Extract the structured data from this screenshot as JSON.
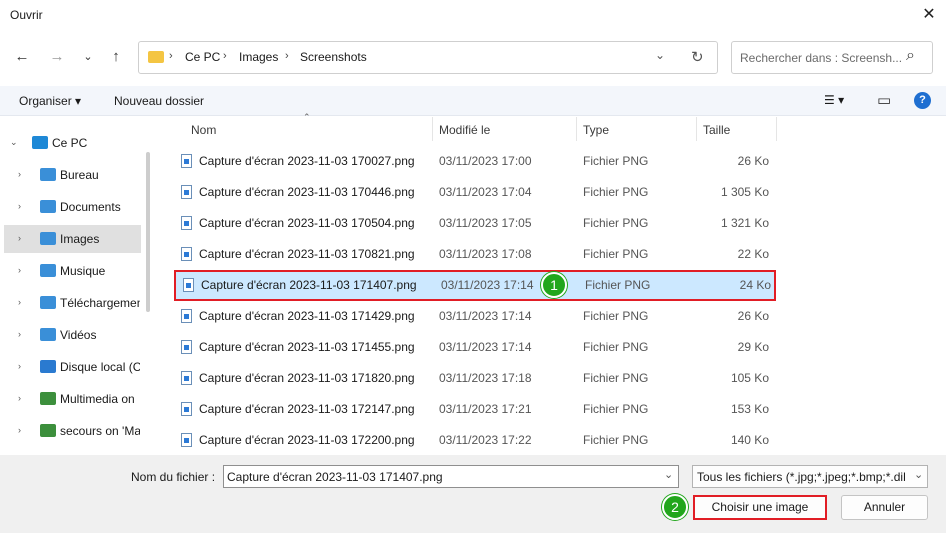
{
  "window": {
    "title": "Ouvrir",
    "close_glyph": "✕"
  },
  "nav": {
    "back": "←",
    "forward": "→",
    "recent": "⌄",
    "up": "↑",
    "breadcrumb": [
      "Ce PC",
      "Images",
      "Screenshots"
    ],
    "separator": "›",
    "dropdown_glyph": "⌄",
    "refresh_glyph": "↻",
    "search_placeholder": "Rechercher dans : Screensh...",
    "search_glyph": "⌕"
  },
  "toolbar": {
    "organize": "Organiser ▾",
    "new_folder": "Nouveau dossier",
    "view_glyph": "☰ ▾",
    "pane_glyph": "▭",
    "help_glyph": "?"
  },
  "sidebar": {
    "items": [
      {
        "label": "Ce PC",
        "chevron": "⌄",
        "icon": "monitor-icon",
        "color": "#1e88d6"
      },
      {
        "label": "Bureau",
        "chevron": "›",
        "icon": "desktop-folder-icon",
        "color": "#3a8fd8"
      },
      {
        "label": "Documents",
        "chevron": "›",
        "icon": "documents-folder-icon",
        "color": "#3a8fd8"
      },
      {
        "label": "Images",
        "chevron": "›",
        "icon": "images-folder-icon",
        "color": "#3a8fd8"
      },
      {
        "label": "Musique",
        "chevron": "›",
        "icon": "music-folder-icon",
        "color": "#3a8fd8"
      },
      {
        "label": "Téléchargements",
        "chevron": "›",
        "icon": "downloads-folder-icon",
        "color": "#3a8fd8"
      },
      {
        "label": "Vidéos",
        "chevron": "›",
        "icon": "videos-folder-icon",
        "color": "#3a8fd8"
      },
      {
        "label": "Disque local (C:)",
        "chevron": "›",
        "icon": "windows-drive-icon",
        "color": "#2a7ad0"
      },
      {
        "label": "Multimedia on",
        "chevron": "›",
        "icon": "network-drive-icon",
        "color": "#3c8f3c"
      },
      {
        "label": "secours on 'Ma",
        "chevron": "›",
        "icon": "network-drive-icon",
        "color": "#3c8f3c"
      }
    ],
    "selected_index": 3
  },
  "columns": {
    "name": "Nom",
    "modified": "Modifié le",
    "type": "Type",
    "size": "Taille",
    "sort_glyph": "⌃"
  },
  "files": [
    {
      "name": "Capture d'écran 2023-11-03 170027.png",
      "modified": "03/11/2023 17:00",
      "type": "Fichier PNG",
      "size": "26 Ko"
    },
    {
      "name": "Capture d'écran 2023-11-03 170446.png",
      "modified": "03/11/2023 17:04",
      "type": "Fichier PNG",
      "size": "1 305 Ko"
    },
    {
      "name": "Capture d'écran 2023-11-03 170504.png",
      "modified": "03/11/2023 17:05",
      "type": "Fichier PNG",
      "size": "1 321 Ko"
    },
    {
      "name": "Capture d'écran 2023-11-03 170821.png",
      "modified": "03/11/2023 17:08",
      "type": "Fichier PNG",
      "size": "22 Ko"
    },
    {
      "name": "Capture d'écran 2023-11-03 171407.png",
      "modified": "03/11/2023 17:14",
      "type": "Fichier PNG",
      "size": "24 Ko"
    },
    {
      "name": "Capture d'écran 2023-11-03 171429.png",
      "modified": "03/11/2023 17:14",
      "type": "Fichier PNG",
      "size": "26 Ko"
    },
    {
      "name": "Capture d'écran 2023-11-03 171455.png",
      "modified": "03/11/2023 17:14",
      "type": "Fichier PNG",
      "size": "29 Ko"
    },
    {
      "name": "Capture d'écran 2023-11-03 171820.png",
      "modified": "03/11/2023 17:18",
      "type": "Fichier PNG",
      "size": "105 Ko"
    },
    {
      "name": "Capture d'écran 2023-11-03 172147.png",
      "modified": "03/11/2023 17:21",
      "type": "Fichier PNG",
      "size": "153 Ko"
    },
    {
      "name": "Capture d'écran 2023-11-03 172200.png",
      "modified": "03/11/2023 17:22",
      "type": "Fichier PNG",
      "size": "140 Ko"
    }
  ],
  "selected_file_index": 4,
  "bottom": {
    "filename_label": "Nom du fichier :",
    "filename_value": "Capture d'écran 2023-11-03 171407.png",
    "filter_value": "Tous les fichiers (*.jpg;*.jpeg;*.bmp;*.dib",
    "dropdown_glyph": "⌄",
    "open_button": "Choisir une image",
    "cancel_button": "Annuler"
  },
  "annotations": {
    "badge1": "1",
    "badge2": "2",
    "highlight_color": "#e11d25",
    "badge_color": "#22a61c"
  }
}
